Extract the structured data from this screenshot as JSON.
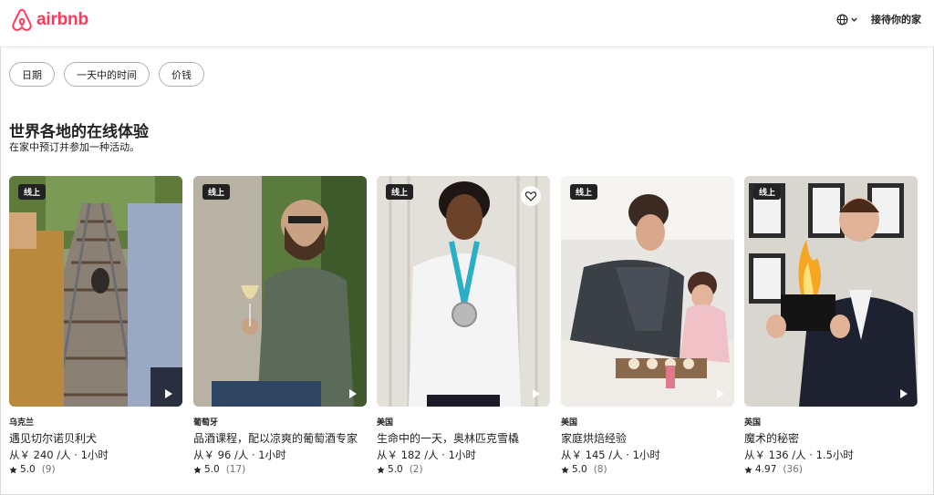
{
  "brand": {
    "name": "airbnb",
    "color": "#FF385C"
  },
  "header": {
    "host_label": "接待你的家"
  },
  "filters": [
    "日期",
    "一天中的时间",
    "价钱"
  ],
  "section": {
    "title": "世界各地的在线体验",
    "subtitle": "在家中预订并参加一种活动。"
  },
  "cards": [
    {
      "badge": "线上",
      "country": "乌克兰",
      "name": "遇见切尔诺贝利犬",
      "price": "从￥ 240 /人 · 1小时",
      "rating": "5.0",
      "reviews": "(9)",
      "favorite_icon": false
    },
    {
      "badge": "线上",
      "country": "葡萄牙",
      "name": "品酒课程，配以凉爽的葡萄酒专家",
      "price": "从￥ 96 /人 · 1小时",
      "rating": "5.0",
      "reviews": "(17)",
      "favorite_icon": false
    },
    {
      "badge": "线上",
      "country": "美国",
      "name": "生命中的一天，奥林匹克雪橇",
      "price": "从￥ 182 /人 · 1小时",
      "rating": "5.0",
      "reviews": "(2)",
      "favorite_icon": true
    },
    {
      "badge": "线上",
      "country": "美国",
      "name": "家庭烘焙经验",
      "price": "从￥ 145 /人 · 1小时",
      "rating": "5.0",
      "reviews": "(8)",
      "favorite_icon": false
    },
    {
      "badge": "线上",
      "country": "英国",
      "name": "魔术的秘密",
      "price": "从￥ 136 /人 · 1.5小时",
      "rating": "4.97",
      "reviews": "(36)",
      "favorite_icon": false
    }
  ]
}
